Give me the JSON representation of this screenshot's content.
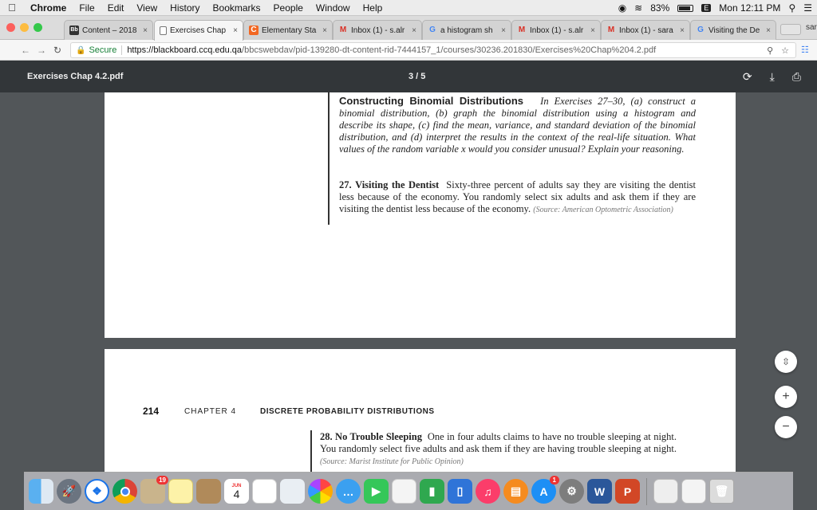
{
  "menubar": {
    "app": "Chrome",
    "items": [
      "File",
      "Edit",
      "View",
      "History",
      "Bookmarks",
      "People",
      "Window",
      "Help"
    ],
    "battery": "83%",
    "clock": "Mon 12:11 PM"
  },
  "tabs": [
    {
      "label": "Content – 2018",
      "icon": "blackboard-icon",
      "color": "#333333",
      "active": false
    },
    {
      "label": "Exercises Chap",
      "icon": "document-icon",
      "color": "#777777",
      "active": true
    },
    {
      "label": "Elementary Sta",
      "icon": "chegg-icon",
      "color": "#f26722",
      "active": false
    },
    {
      "label": "Inbox (1) - s.alr",
      "icon": "gmail-icon",
      "color": "#d93025",
      "active": false
    },
    {
      "label": "a histogram sh",
      "icon": "google-icon",
      "color": "#4285f4",
      "active": false
    },
    {
      "label": "Inbox (1) - s.alr",
      "icon": "gmail-icon",
      "color": "#d93025",
      "active": false
    },
    {
      "label": "Inbox (1) - sara",
      "icon": "gmail-icon",
      "color": "#d93025",
      "active": false
    },
    {
      "label": "Visiting the De",
      "icon": "google-icon",
      "color": "#4285f4",
      "active": false
    }
  ],
  "profile_label": "sar",
  "address": {
    "secure_label": "Secure",
    "url_host": "https://blackboard.ccq.edu.qa",
    "url_path": "/bbcswebdav/pid-139280-dt-content-rid-7444157_1/courses/30236.201830/Exercises%20Chap%204.2.pdf"
  },
  "pdf": {
    "filename": "Exercises Chap 4.2.pdf",
    "page_indicator": "3 / 5"
  },
  "page1": {
    "heading": "Constructing Binomial Distributions",
    "instructions": "In Exercises 27–30, (a) construct a binomial distribution, (b) graph the binomial distribution using a histogram and describe its shape, (c) find the mean, variance, and standard deviation of the binomial distribution, and (d) interpret the results in the context of the real-life situation. What values of the random variable x would you consider unusual? Explain your reasoning.",
    "ex27_number": "27.",
    "ex27_title": "Visiting the Dentist",
    "ex27_text": "Sixty-three percent of adults say they are visiting the dentist less because of the economy. You randomly select six adults and ask them if they are visiting the dentist less because of the economy.",
    "ex27_source": "(Source: American Optometric Association)"
  },
  "page2": {
    "page_number": "214",
    "chapter": "CHAPTER 4",
    "chapter_title": "DISCRETE PROBABILITY DISTRIBUTIONS",
    "ex28_number": "28.",
    "ex28_title": "No Trouble Sleeping",
    "ex28_text": "One in four adults claims to have no trouble sleeping at night. You randomly select five adults and ask them if they are having trouble sleeping at night.",
    "ex28_source": "(Source: Marist Institute for Public Opinion)"
  },
  "zoom_controls": {
    "fit": "⇳",
    "zoom_in": "+",
    "zoom_out": "−"
  },
  "dock": {
    "calendar_month": "JUN",
    "calendar_day": "4",
    "badge_notes": "19",
    "badge_appstore": "1",
    "apps": [
      "finder-icon",
      "launchpad-icon",
      "safari-icon",
      "chrome-icon",
      "photos-badge-icon",
      "notes-icon",
      "contacts-icon",
      "calendar-icon",
      "reminders-icon",
      "preview-icon",
      "photos-icon",
      "messages-icon",
      "facetime-icon",
      "textedit-icon",
      "numbers-icon",
      "keynote-icon",
      "music-icon",
      "ibooks-icon",
      "appstore-icon",
      "system-preferences-icon",
      "word-icon",
      "powerpoint-icon"
    ]
  }
}
